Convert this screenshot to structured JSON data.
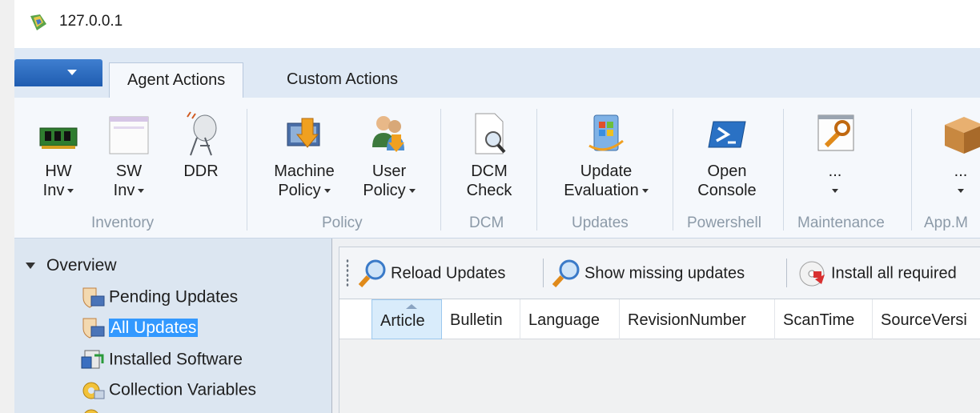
{
  "window": {
    "title": "127.0.0.1"
  },
  "tabs": [
    {
      "label": "Agent Actions",
      "active": true
    },
    {
      "label": "Custom Actions",
      "active": false
    }
  ],
  "ribbon": {
    "buttons": {
      "hw_inv": [
        "HW",
        "Inv"
      ],
      "sw_inv": [
        "SW",
        "Inv"
      ],
      "ddr": [
        "DDR"
      ],
      "machine_policy": [
        "Machine",
        "Policy"
      ],
      "user_policy": [
        "User",
        "Policy"
      ],
      "dcm_check": [
        "DCM",
        "Check"
      ],
      "update_eval": [
        "Update",
        "Evaluation"
      ],
      "open_console": [
        "Open",
        "Console"
      ],
      "maintenance_more": [
        "..."
      ],
      "appm_more": [
        "..."
      ]
    },
    "groups": [
      "Inventory",
      "Policy",
      "DCM",
      "Updates",
      "Powershell",
      "Maintenance",
      "App.M"
    ]
  },
  "tree": {
    "root": "Overview",
    "items": [
      "Pending Updates",
      "All Updates",
      "Installed Software",
      "Collection Variables"
    ],
    "selected": "All Updates"
  },
  "toolbar": {
    "reload": "Reload Updates",
    "show_missing": "Show missing updates",
    "install_all": "Install all required"
  },
  "grid": {
    "columns": [
      "Article",
      "Bulletin",
      "Language",
      "RevisionNumber",
      "ScanTime",
      "SourceVersi"
    ],
    "sorted_column": "Article"
  },
  "colors": {
    "accent": "#3399ff",
    "app_menu": "#2a6bc2",
    "tree_bg": "#dce6f1",
    "group_label": "#8c9aa8"
  }
}
